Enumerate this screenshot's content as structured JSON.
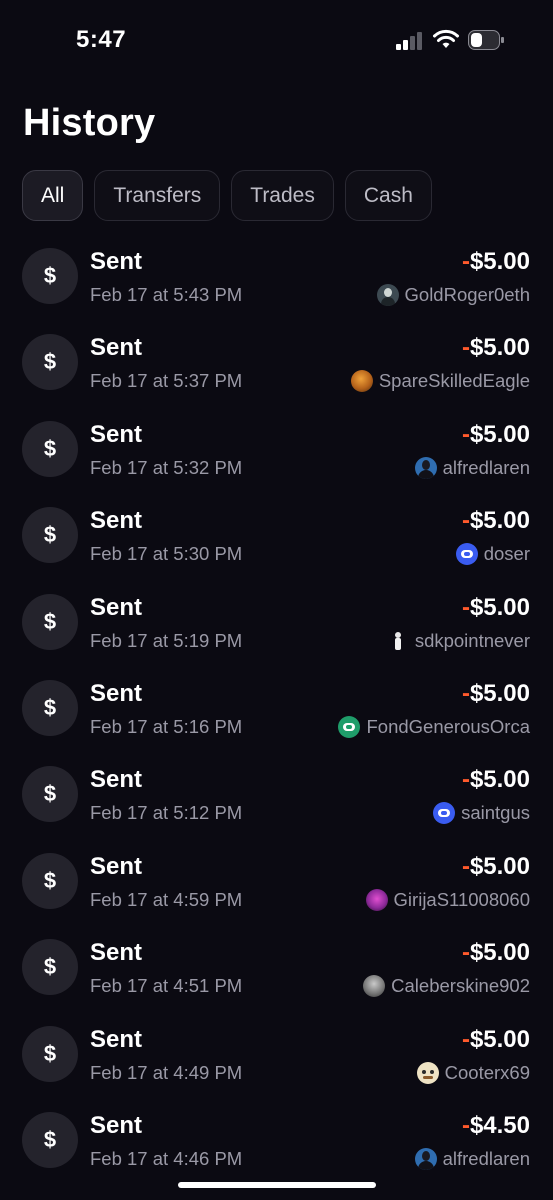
{
  "status": {
    "time": "5:47"
  },
  "page": {
    "title": "History"
  },
  "filters": [
    {
      "label": "All",
      "active": true
    },
    {
      "label": "Transfers",
      "active": false
    },
    {
      "label": "Trades",
      "active": false
    },
    {
      "label": "Cash",
      "active": false
    }
  ],
  "colors": {
    "negative_sign": "#ff5a2c",
    "background": "#0b0a12",
    "icon_bg": "#24232c"
  },
  "transactions": [
    {
      "icon": "dollar-icon",
      "icon_glyph": "$",
      "label": "Sent",
      "date": "Feb 17 at 5:43 PM",
      "sign": "-",
      "amount": "$5.00",
      "counterparty": "GoldRoger0eth",
      "avatar": "dark-portrait"
    },
    {
      "icon": "dollar-icon",
      "icon_glyph": "$",
      "label": "Sent",
      "date": "Feb 17 at 5:37 PM",
      "sign": "-",
      "amount": "$5.00",
      "counterparty": "SpareSkilledEagle",
      "avatar": "orange-portrait"
    },
    {
      "icon": "dollar-icon",
      "icon_glyph": "$",
      "label": "Sent",
      "date": "Feb 17 at 5:32 PM",
      "sign": "-",
      "amount": "$5.00",
      "counterparty": "alfredlaren",
      "avatar": "blue-portrait"
    },
    {
      "icon": "dollar-icon",
      "icon_glyph": "$",
      "label": "Sent",
      "date": "Feb 17 at 5:30 PM",
      "sign": "-",
      "amount": "$5.00",
      "counterparty": "doser",
      "avatar": "blue-logo"
    },
    {
      "icon": "dollar-icon",
      "icon_glyph": "$",
      "label": "Sent",
      "date": "Feb 17 at 5:19 PM",
      "sign": "-",
      "amount": "$5.00",
      "counterparty": "sdkpointnever",
      "avatar": "figure-portrait"
    },
    {
      "icon": "dollar-icon",
      "icon_glyph": "$",
      "label": "Sent",
      "date": "Feb 17 at 5:16 PM",
      "sign": "-",
      "amount": "$5.00",
      "counterparty": "FondGenerousOrca",
      "avatar": "green-logo"
    },
    {
      "icon": "dollar-icon",
      "icon_glyph": "$",
      "label": "Sent",
      "date": "Feb 17 at 5:12 PM",
      "sign": "-",
      "amount": "$5.00",
      "counterparty": "saintgus",
      "avatar": "blue-logo"
    },
    {
      "icon": "dollar-icon",
      "icon_glyph": "$",
      "label": "Sent",
      "date": "Feb 17 at 4:59 PM",
      "sign": "-",
      "amount": "$5.00",
      "counterparty": "GirijaS11008060",
      "avatar": "purple-portrait"
    },
    {
      "icon": "dollar-icon",
      "icon_glyph": "$",
      "label": "Sent",
      "date": "Feb 17 at 4:51 PM",
      "sign": "-",
      "amount": "$5.00",
      "counterparty": "Caleberskine902",
      "avatar": "gray-portrait"
    },
    {
      "icon": "dollar-icon",
      "icon_glyph": "$",
      "label": "Sent",
      "date": "Feb 17 at 4:49 PM",
      "sign": "-",
      "amount": "$5.00",
      "counterparty": "Cooterx69",
      "avatar": "cartoon-portrait"
    },
    {
      "icon": "dollar-icon",
      "icon_glyph": "$",
      "label": "Sent",
      "date": "Feb 17 at 4:46 PM",
      "sign": "-",
      "amount": "$4.50",
      "counterparty": "alfredlaren",
      "avatar": "blue-portrait"
    }
  ]
}
